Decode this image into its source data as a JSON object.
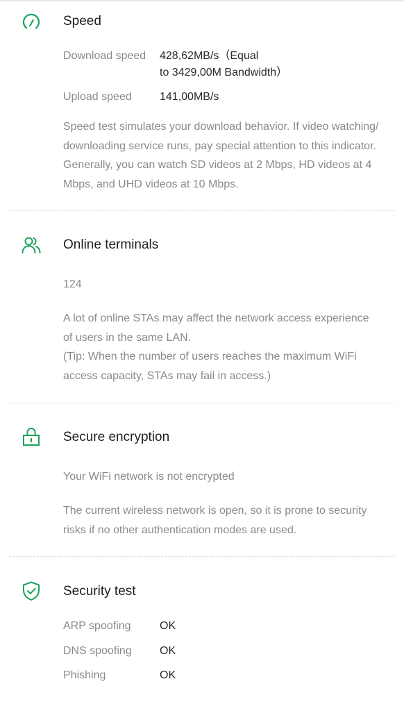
{
  "colors": {
    "accent_green": "#1aa35b",
    "text_primary": "#1f1f1f",
    "text_secondary": "#8a8a8a"
  },
  "speed": {
    "icon": "speedometer-icon",
    "title": "Speed",
    "download_label": "Download speed",
    "download_value_line1": "428,62MB/s（Equal",
    "download_value_line2": "to 3429,00M Bandwidth）",
    "upload_label": "Upload speed",
    "upload_value": "141,00MB/s",
    "description_lines": [
      "Speed test simulates your download behavior. If video watching/",
      "downloading service runs, pay special attention to this indicator.",
      "Generally, you can watch SD videos at 2 Mbps, HD videos at 4",
      "Mbps, and UHD videos at 10 Mbps."
    ]
  },
  "terminals": {
    "icon": "users-icon",
    "title": "Online terminals",
    "count": "124",
    "description_lines": [
      "A lot of online STAs may affect the network access experience",
      "of users in the same LAN.",
      "(Tip: When the number of users reaches the maximum WiFi",
      "access capacity, STAs may fail in access.)"
    ]
  },
  "encryption": {
    "icon": "lock-icon",
    "title": "Secure encryption",
    "status": "Your WiFi network is not encrypted",
    "description_lines": [
      "The current wireless network is open, so it is prone to security",
      "risks if no other authentication modes are used."
    ]
  },
  "security": {
    "icon": "shield-check-icon",
    "title": "Security test",
    "rows": [
      {
        "label": "ARP spoofing",
        "value": "OK"
      },
      {
        "label": "DNS spoofing",
        "value": "OK"
      },
      {
        "label": "Phishing",
        "value": "OK"
      }
    ]
  }
}
